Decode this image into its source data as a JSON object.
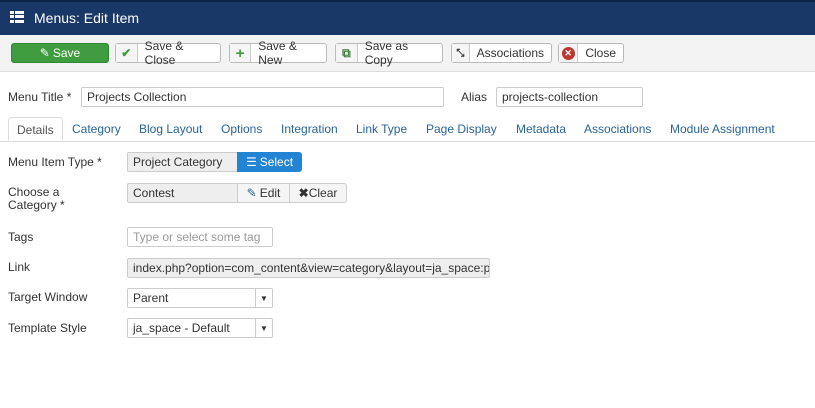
{
  "header": {
    "title": "Menus: Edit Item"
  },
  "toolbar": {
    "save": "Save",
    "save_close": "Save & Close",
    "save_new": "Save & New",
    "save_copy": "Save as Copy",
    "associations": "Associations",
    "close": "Close"
  },
  "form": {
    "menu_title_label": "Menu Title *",
    "menu_title_value": "Projects Collection",
    "alias_label": "Alias",
    "alias_value": "projects-collection"
  },
  "tabs": [
    "Details",
    "Category",
    "Blog Layout",
    "Options",
    "Integration",
    "Link Type",
    "Page Display",
    "Metadata",
    "Associations",
    "Module Assignment"
  ],
  "details": {
    "type_label": "Menu Item Type *",
    "type_value": "Project Category",
    "select_label": "Select",
    "cat_label": "Choose a Category *",
    "cat_value": "Contest",
    "edit_label": "Edit",
    "clear_label": "Clear",
    "tags_label": "Tags",
    "tags_placeholder": "Type or select some tag",
    "link_label": "Link",
    "link_value": "index.php?option=com_content&view=category&layout=ja_space:p",
    "target_label": "Target Window",
    "target_value": "Parent",
    "template_label": "Template Style",
    "template_value": "ja_space - Default"
  }
}
